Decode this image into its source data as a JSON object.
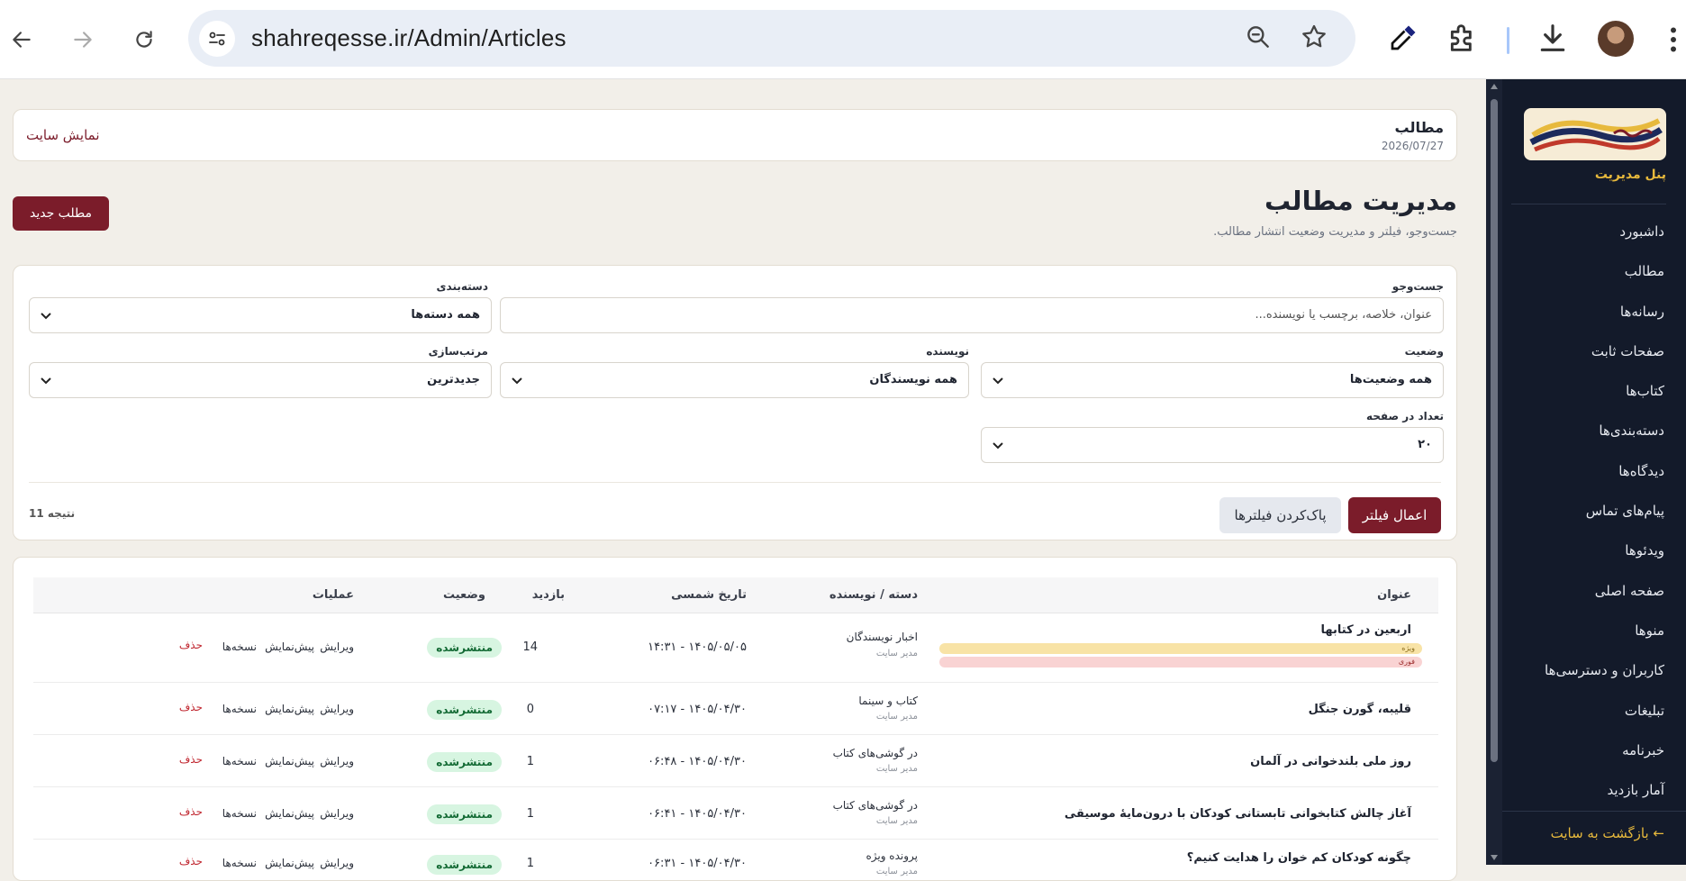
{
  "browser": {
    "url": "shahreqesse.ir/Admin/Articles"
  },
  "sidebar": {
    "panel_title": "پنل مدیریت",
    "items": [
      {
        "label": "داشبورد"
      },
      {
        "label": "مطالب"
      },
      {
        "label": "رسانه‌ها"
      },
      {
        "label": "صفحات ثابت"
      },
      {
        "label": "کتاب‌ها"
      },
      {
        "label": "دسته‌بندی‌ها"
      },
      {
        "label": "دیدگاه‌ها"
      },
      {
        "label": "پیام‌های تماس"
      },
      {
        "label": "ویدئوها"
      },
      {
        "label": "صفحه اصلی"
      },
      {
        "label": "منوها"
      },
      {
        "label": "کاربران و دسترسی‌ها"
      },
      {
        "label": "تبلیغات"
      },
      {
        "label": "خبرنامه"
      },
      {
        "label": "آمار بازدید"
      }
    ],
    "back_label": "← بازگشت به سایت"
  },
  "topbar": {
    "title": "مطالب",
    "date": "2026/07/27",
    "view_site": "نمایش سایت"
  },
  "header": {
    "title": "مدیریت مطالب",
    "subtitle": "جست‌وجو، فیلتر و مدیریت وضعیت انتشار مطالب.",
    "new_button": "مطلب جدید"
  },
  "filters": {
    "search_label": "جست‌وجو",
    "search_placeholder": "عنوان، خلاصه، برچسب یا نویسنده...",
    "category_label": "دسته‌بندی",
    "category_value": "همه دسته‌ها",
    "status_label": "وضعیت",
    "status_value": "همه وضعیت‌ها",
    "author_label": "نویسنده",
    "author_value": "همه نویسندگان",
    "sort_label": "مرتب‌سازی",
    "sort_value": "جدیدترین",
    "per_page_label": "تعداد در صفحه",
    "per_page_value": "۲۰",
    "apply_button": "اعمال فیلتر",
    "clear_button": "پاک‌کردن فیلترها",
    "results": "11 نتیجه"
  },
  "table": {
    "headers": {
      "title": "عنوان",
      "category_author": "دسته / نویسنده",
      "date": "تاریخ شمسی",
      "views": "بازدید",
      "status": "وضعیت",
      "actions": "عملیات"
    },
    "action_labels": {
      "edit": "ویرایش",
      "preview": "پیش‌نمایش",
      "versions": "نسخه‌ها",
      "delete": "حذف"
    },
    "rows": [
      {
        "title": "اربعین در کتابها",
        "category": "اخبار نویسندگان",
        "author": "مدیر سایت",
        "date": "۱۴۰۵/۰۵/۰۵ - ۱۴:۳۱",
        "views": "14",
        "status": "منتشرشده",
        "tags": [
          "ویژه",
          "فوری"
        ]
      },
      {
        "title": "قلیبه، گورن جنگل",
        "category": "کتاب و سینما",
        "author": "مدیر سایت",
        "date": "۱۴۰۵/۰۴/۳۰ - ۰۷:۱۷",
        "views": "0",
        "status": "منتشرشده",
        "tags": []
      },
      {
        "title": "روز ملی بلندخوانی در آلمان",
        "category": "در گوشی‌های کتاب",
        "author": "مدیر سایت",
        "date": "۱۴۰۵/۰۴/۳۰ - ۰۶:۴۸",
        "views": "1",
        "status": "منتشرشده",
        "tags": []
      },
      {
        "title": "آغاز چالش کتابخوانی تابستانی کودکان با درون‌مایهٔ موسیقی",
        "category": "در گوشی‌های کتاب",
        "author": "مدیر سایت",
        "date": "۱۴۰۵/۰۴/۳۰ - ۰۶:۴۱",
        "views": "1",
        "status": "منتشرشده",
        "tags": []
      },
      {
        "title": "چگونه کودکان کم خوان را هدایت کنیم؟",
        "category": "پرونده ویژه",
        "author": "مدیر سایت",
        "date": "۱۴۰۵/۰۴/۳۰ - ۰۶:۳۱",
        "views": "1",
        "status": "منتشرشده",
        "tags": []
      }
    ]
  },
  "colors": {
    "brand": "#7b1c2a",
    "sidebar_bg": "#131a2a",
    "accent_gold": "#e7b93c",
    "published_bg": "#d7f5e1",
    "featured_tag": "#f8e3a6",
    "urgent_tag": "#f9d3d3"
  }
}
